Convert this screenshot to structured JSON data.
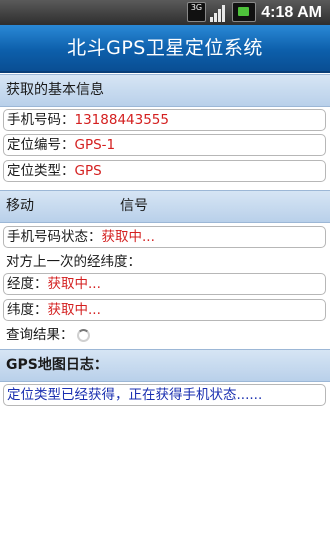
{
  "status_bar": {
    "network": "3G",
    "time": "4:18 AM"
  },
  "title": "北斗GPS卫星定位系统",
  "basic": {
    "header": "获取的基本信息",
    "phone_label": "手机号码：",
    "phone_value": "13188443555",
    "id_label": "定位编号：",
    "id_value": "GPS-1",
    "type_label": "定位类型：",
    "type_value": "GPS"
  },
  "signal": {
    "mobile_label": "移动",
    "signal_label": "信号",
    "phone_status_label": "手机号码状态：",
    "phone_status_value": "获取中..."
  },
  "last_position": {
    "heading": "对方上一次的经纬度：",
    "lon_label": "经度：",
    "lon_value": "获取中...",
    "lat_label": "纬度：",
    "lat_value": "获取中...",
    "query_label": "查询结果："
  },
  "log": {
    "header": "GPS地图日志：",
    "message": "定位类型已经获得，正在获得手机状态......"
  },
  "colors": {
    "accent": "#0d5fab",
    "value_red": "#d42020",
    "log_blue": "#1a2fb0"
  }
}
